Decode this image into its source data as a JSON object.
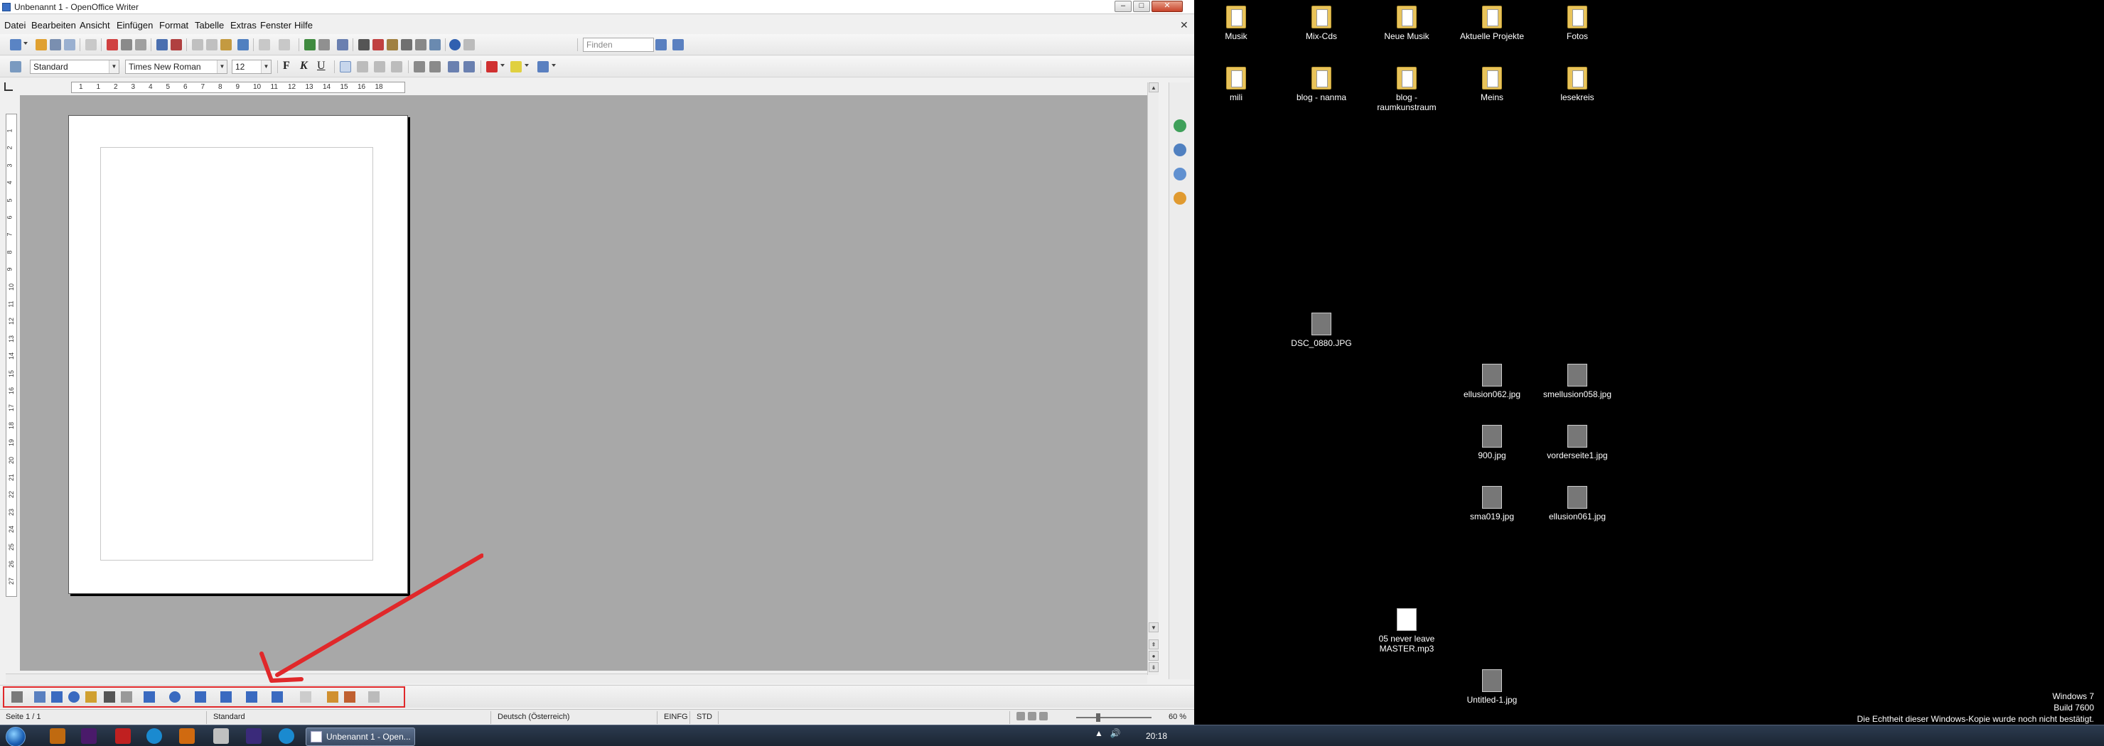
{
  "window": {
    "title": "Unbenannt 1 - OpenOffice Writer",
    "minimize": "–",
    "maximize": "□",
    "close": "✕",
    "doc_close": "✕"
  },
  "menu": [
    "Datei",
    "Bearbeiten",
    "Ansicht",
    "Einfügen",
    "Format",
    "Tabelle",
    "Extras",
    "Fenster",
    "Hilfe"
  ],
  "toolbar": {
    "find_placeholder": "Finden",
    "style": "Standard",
    "font": "Times New Roman",
    "size": "12",
    "bold": "F",
    "italic": "K",
    "underline": "U"
  },
  "ruler_h": [
    "1",
    "1",
    "2",
    "3",
    "4",
    "5",
    "6",
    "7",
    "8",
    "9",
    "10",
    "11",
    "12",
    "13",
    "14",
    "15",
    "16",
    "18"
  ],
  "ruler_v": [
    "1",
    "2",
    "3",
    "4",
    "5",
    "6",
    "7",
    "8",
    "9",
    "10",
    "11",
    "12",
    "13",
    "14",
    "15",
    "16",
    "17",
    "18",
    "19",
    "20",
    "21",
    "22",
    "23",
    "24",
    "25",
    "26",
    "27"
  ],
  "status": {
    "page": "Seite 1 / 1",
    "style": "Standard",
    "language": "Deutsch (Österreich)",
    "insert_mode": "EINFG",
    "selection_mode": "STD",
    "zoom": "60 %"
  },
  "desktop": {
    "icons": [
      {
        "label": "Musik",
        "kind": "folder"
      },
      {
        "label": "Mix-Cds",
        "kind": "folder"
      },
      {
        "label": "Neue Musik",
        "kind": "folder"
      },
      {
        "label": "Aktuelle Projekte",
        "kind": "folder"
      },
      {
        "label": "Fotos",
        "kind": "folder"
      },
      {
        "label": "mili",
        "kind": "folder"
      },
      {
        "label": "blog - nanma",
        "kind": "folder"
      },
      {
        "label": "blog - raumkunstraum",
        "kind": "folder"
      },
      {
        "label": "Meins",
        "kind": "folder"
      },
      {
        "label": "lesekreis",
        "kind": "folder"
      },
      {
        "label": "DSC_0880.JPG",
        "kind": "image"
      },
      {
        "label": "ellusion062.jpg",
        "kind": "image"
      },
      {
        "label": "smellusion058.jpg",
        "kind": "image"
      },
      {
        "label": "900.jpg",
        "kind": "image"
      },
      {
        "label": "vorderseite1.jpg",
        "kind": "image"
      },
      {
        "label": "sma019.jpg",
        "kind": "image"
      },
      {
        "label": "ellusion061.jpg",
        "kind": "image"
      },
      {
        "label": "05 never leave MASTER.mp3",
        "kind": "file"
      },
      {
        "label": "Untitled-1.jpg",
        "kind": "image"
      }
    ],
    "watermark_line1": "Windows 7",
    "watermark_line2": "Build 7600",
    "watermark_line3": "Die Echtheit dieser Windows-Kopie wurde noch nicht bestätigt."
  },
  "taskbar": {
    "active_window": "Unbenannt 1 - Open...",
    "clock": "20:18",
    "apps": [
      "adobe-illustrator-icon",
      "adobe-premiere-icon",
      "acrobat-icon",
      "skype-icon",
      "flash-icon",
      "winamp-icon",
      "adobe-after-effects-icon",
      "skype-icon"
    ]
  },
  "colors": {
    "highlight_red": "#e0282a",
    "doc_background": "#a8a8a8"
  }
}
